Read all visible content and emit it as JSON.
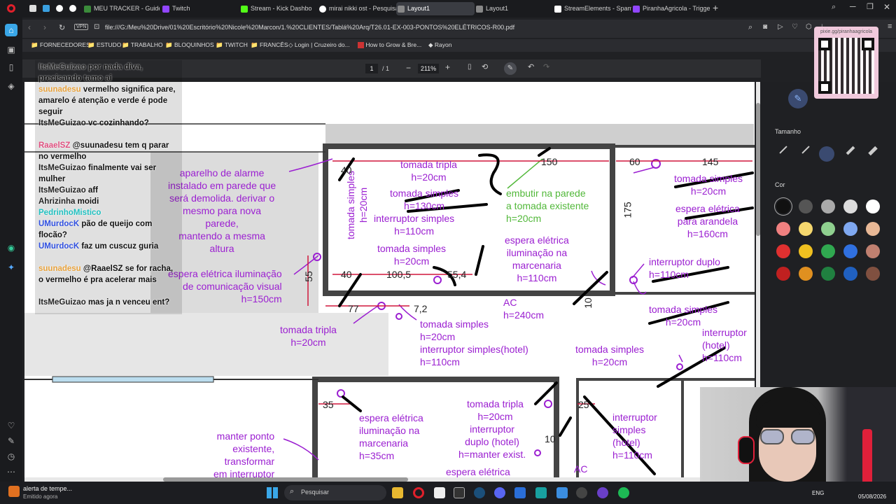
{
  "tabs": [
    {
      "label": "MEU TRACKER - Guides b",
      "color": "#3b8b3b"
    },
    {
      "label": "Twitch",
      "color": "#9146ff"
    },
    {
      "label": "Stream - Kick Dashbo",
      "color": "#53fc18"
    },
    {
      "label": "mirai nikki ost - Pesquisa",
      "color": "#ffffff"
    },
    {
      "label": "Layout1",
      "color": "#888888"
    },
    {
      "label": "Layout1",
      "color": "#888888"
    },
    {
      "label": "StreamElements - Spam fi",
      "color": "#ffffff"
    },
    {
      "label": "PiranhaAgricola - Trigger",
      "color": "#9146ff"
    }
  ],
  "address": {
    "url": "file:///G:/Meu%20Drive/01%20Escritório%20Nicole%20Marcon/1.%20CLIENTES/Tablá%20Arq/T26.01-EX-003-PONTOS%20ELÉTRICOS-R00.pdf",
    "vpn": "VPN"
  },
  "bookmarks": [
    "FORNECEDORES",
    "ESTUDO",
    "TRABALHO",
    "BLOQUINHOS",
    "TWITCH",
    "FRANCÊS",
    "Login | Cruzeiro do...",
    "How to Grow & Bre...",
    "Rayon"
  ],
  "pdf": {
    "page": "1",
    "total": "/ 1",
    "zoom": "211%"
  },
  "draw": {
    "size_label": "Tamanho",
    "color_label": "Cor",
    "colors": [
      "#111111",
      "#555555",
      "#aaaaaa",
      "#dddddd",
      "#ffffff",
      "#f08080",
      "#f5d76e",
      "#8fd08f",
      "#7fa8f0",
      "#e8b896",
      "#e03030",
      "#f0c020",
      "#30a850",
      "#3070e0",
      "#c08070",
      "#c02020",
      "#e09020",
      "#208040",
      "#2060c0",
      "#805040"
    ]
  },
  "qr": {
    "label": "pixie.gg/piranhaagricola"
  },
  "chat": [
    {
      "user": "ItsMeGuizao",
      "text": "por nada diva, precisando tamo ai"
    },
    {
      "user": "suunadesu",
      "text": "vermelho significa pare, amarelo é atenção e verde é pode seguir"
    },
    {
      "user": "ItsMeGuizao",
      "text": "vc cozinhando?"
    },
    {
      "user": "RaaelSZ",
      "text": "@suunadesu tem q parar no vermelho"
    },
    {
      "user": "ItsMeGuizao",
      "text": "finalmente vai ser mulher"
    },
    {
      "user": "ItsMeGuizao",
      "text": "aff"
    },
    {
      "user": "Ahrizinha",
      "text": "moidi"
    },
    {
      "user": "PedrinhoMistico",
      "text": ""
    },
    {
      "user": "UMurdocK",
      "text": "pão de queijo com flocão?"
    },
    {
      "user": "UMurdocK",
      "text": "faz um cuscuz guria"
    },
    {
      "user": "suunadesu",
      "text": "@RaaelSZ se for racha, o vermelho é pra acelerar mais"
    },
    {
      "user": "ItsMeGuizao",
      "text": "mas ja n venceu ent?"
    }
  ],
  "plan": {
    "notes": [
      "aparelho de alarme\ninstalado em parede que\nserá demolida. derivar o\nmesmo para nova\nparede,\nmantendo a mesma\naltura",
      "espera elétrica iluminação\nde comunicação visual\nh=150cm",
      "tomada tripla\nh=20cm",
      "tomada simples\nh=130cm",
      "interruptor simples\nh=110cm",
      "tomada simples\nh=20cm",
      "tomada simples\nh=20cm",
      "embutir na parede\na tomada existente\nh=20cm",
      "espera elétrica\niluminação na\nmarcenaria\nh=110cm",
      "tomada simples\nh=20cm",
      "espera elétrica\npara arandela\nh=160cm",
      "interruptor duplo\nh=110cm",
      "tomada simples\nh=20cm",
      "tomada tripla\nh=20cm",
      "tomada simples\nh=20cm",
      "interruptor simples(hotel)\nh=110cm",
      "AC\nh=240cm",
      "tomada simples\nh=20cm",
      "interruptor\n(hotel)\nh=110cm",
      "espera elétrica\niluminação na\nmarcenaria\nh=35cm",
      "tomada tripla\nh=20cm",
      "interruptor\nduplo (hotel)\nh=manter exist.",
      "espera elétrica",
      "interruptor\nsimples\n(hotel)\nh=110cm",
      "manter ponto\nexistente,\ntransformar\nem interruptor",
      "AC",
      "tomada simples\nh=20cm"
    ],
    "dims": [
      "40",
      "150",
      "60",
      "145",
      "175",
      "40",
      "100,5",
      "55,4",
      "55",
      "77",
      "7,2",
      "10",
      "35",
      "25",
      "10"
    ]
  },
  "taskbar": {
    "notif_title": "alerta de tempe...",
    "notif_sub": "Emitido agora",
    "search": "Pesquisar",
    "lang": "ENG",
    "date": "05/08/2026"
  }
}
